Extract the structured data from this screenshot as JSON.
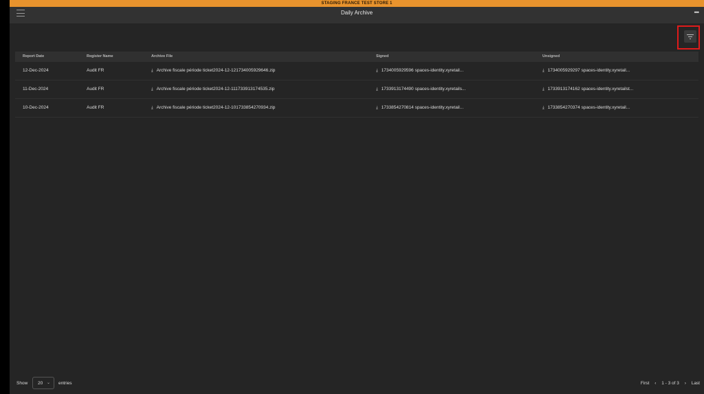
{
  "banner": {
    "text": "STAGING FRANCE TEST STORE 1"
  },
  "header": {
    "title": "Daily Archive",
    "menu_icon": "hamburger-icon",
    "more_icon": "more-icon"
  },
  "toolbar": {
    "filter_icon": "filter-icon"
  },
  "table": {
    "columns": [
      "Report Date",
      "Register Name",
      "Archive File",
      "Signed",
      "Unsigned"
    ],
    "rows": [
      {
        "report_date": "12-Dec-2024",
        "register_name": "Audit FR",
        "archive_file": "Archive fiscale période ticket2024-12-121734005929646.zip",
        "signed": "1734005929596 spaces-identity.xyretail...",
        "unsigned": "1734005929297 spaces-identity.xyretail..."
      },
      {
        "report_date": "11-Dec-2024",
        "register_name": "Audit FR",
        "archive_file": "Archive fiscale période ticket2024-12-111733913174535.zip",
        "signed": "1733913174490 spaces-identity.xyretails...",
        "unsigned": "1733913174162 spaces-identity.xyretailst..."
      },
      {
        "report_date": "10-Dec-2024",
        "register_name": "Audit FR",
        "archive_file": "Archive fiscale période ticket2024-12-101733854270934.zip",
        "signed": "1733854270814 spaces-identity.xyretail...",
        "unsigned": "1733854270374 spaces-identity.xyretail..."
      }
    ]
  },
  "footer": {
    "show_label": "Show",
    "page_size": "20",
    "entries_label": "entries",
    "first": "First",
    "prev": "‹",
    "range": "1 - 3 of 3",
    "next": "›",
    "last": "Last"
  },
  "colors": {
    "banner": "#e8932d",
    "highlight": "#e01b1b",
    "background": "#252525"
  }
}
